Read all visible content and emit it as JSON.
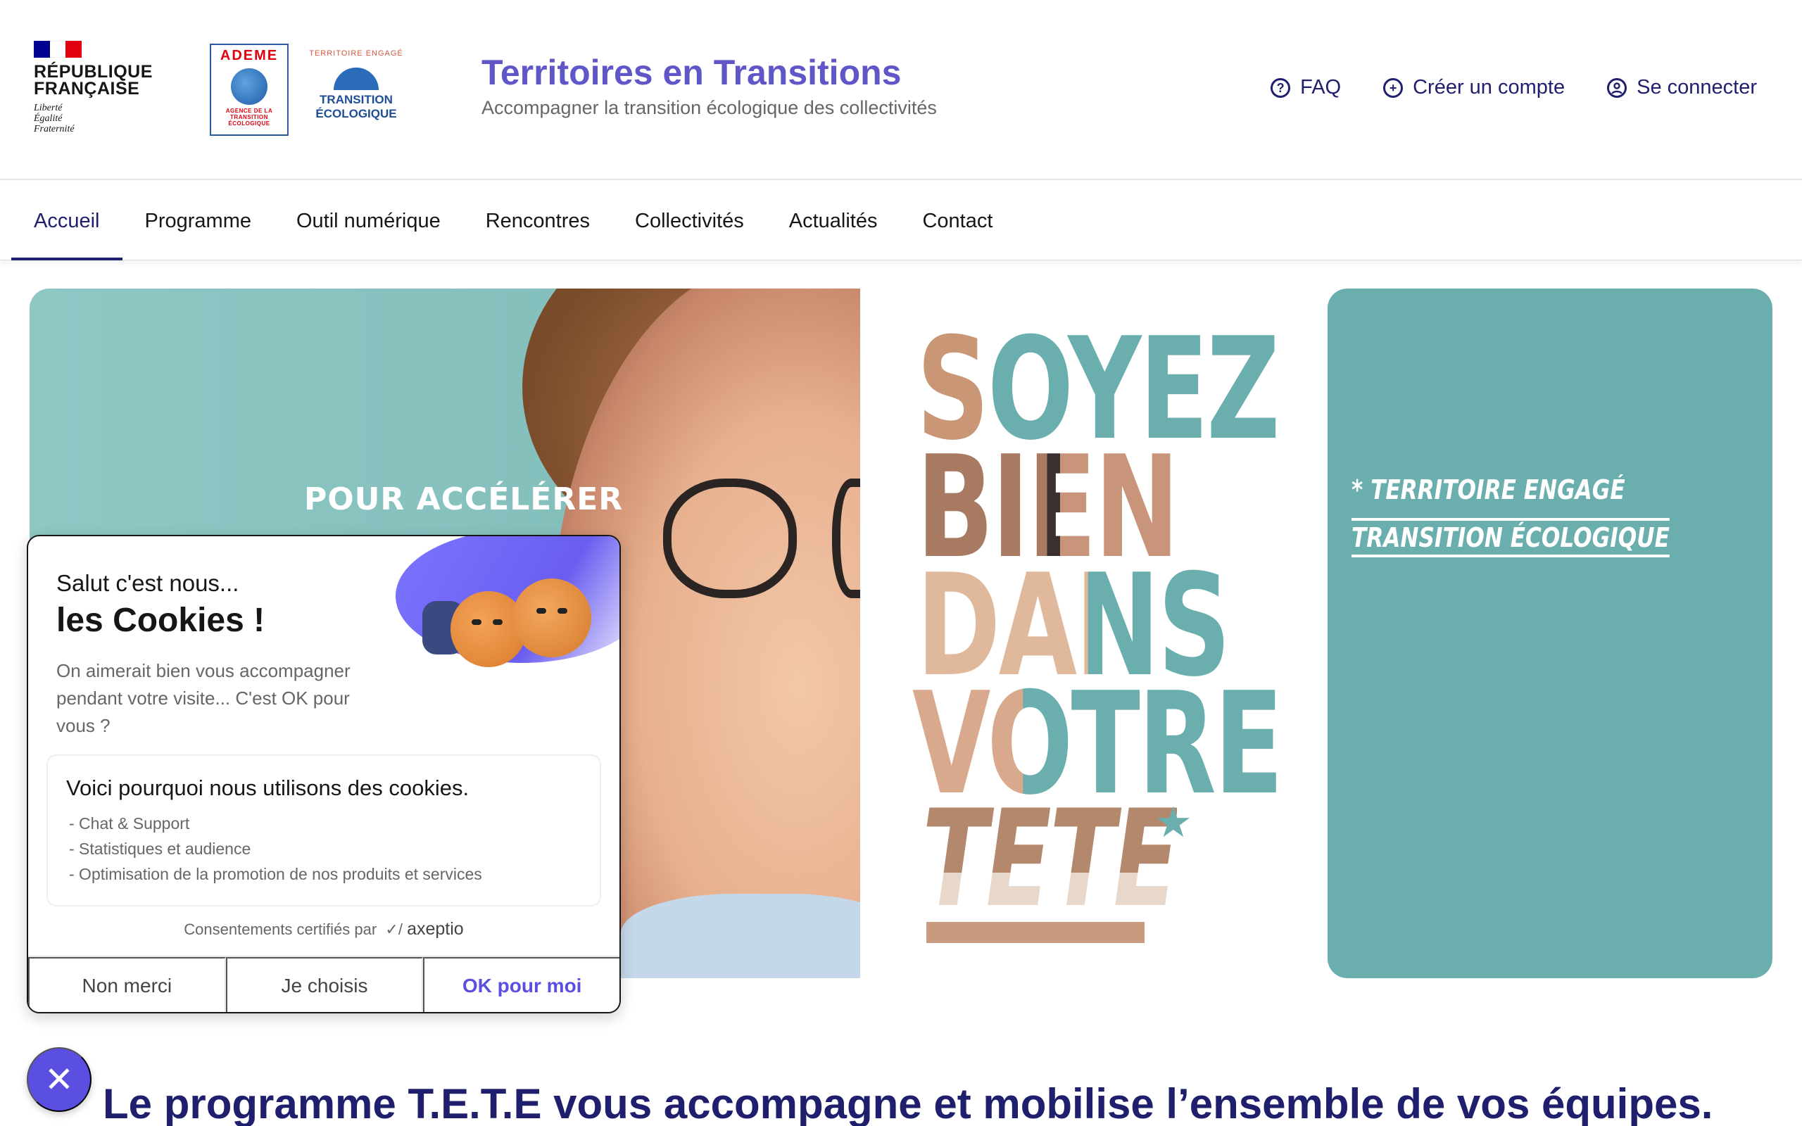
{
  "header": {
    "rf": {
      "line1": "RÉPUBLIQUE",
      "line2": "FRANÇAISE",
      "motto1": "Liberté",
      "motto2": "Égalité",
      "motto3": "Fraternité",
      "flag_colors": [
        "#000091",
        "#ffffff",
        "#e1000f"
      ]
    },
    "ademe": {
      "title": "ADEME",
      "sub1": "AGENCE DE LA",
      "sub2": "TRANSITION",
      "sub3": "ÉCOLOGIQUE"
    },
    "tete": {
      "arc": "TERRITOIRE ENGAGÉ",
      "line1": "TRANSITION",
      "line2": "ÉCOLOGIQUE"
    },
    "site_title": "Territoires en Transitions",
    "tagline": "Accompagner la transition écologique des collectivités",
    "links": [
      {
        "label": "FAQ",
        "icon": "question-circle-icon"
      },
      {
        "label": "Créer un compte",
        "icon": "plus-circle-icon"
      },
      {
        "label": "Se connecter",
        "icon": "user-circle-icon"
      }
    ]
  },
  "nav": {
    "items": [
      "Accueil",
      "Programme",
      "Outil numérique",
      "Rencontres",
      "Collectivités",
      "Actualités",
      "Contact"
    ],
    "active": "Accueil"
  },
  "hero": {
    "left_text1": "POUR ACCÉLÉRER",
    "words": [
      "SOYEZ",
      "BIEN",
      "DANS",
      "VOTRE",
      "TETE"
    ],
    "star": "*",
    "right_line1": "* TERRITOIRE ENGAGÉ",
    "right_line2": "TRANSITION ÉCOLOGIQUE"
  },
  "main": {
    "heading": "Le programme T.E.T.E vous accompagne et mobilise l’ensemble de vos équipes."
  },
  "cookie": {
    "salut": "Salut c'est nous...",
    "title": "les Cookies !",
    "intro": "On aimerait bien vous accompagner pendant votre visite... C'est OK pour vous ?",
    "box_title": "Voici pourquoi nous utilisons des cookies.",
    "reasons": [
      "- Chat & Support",
      "- Statistiques et audience",
      "- Optimisation de la promotion de nos produits et services"
    ],
    "certif": "Consentements certifiés par",
    "brand": "axeptio",
    "buttons": {
      "refuse": "Non merci",
      "choose": "Je choisis",
      "accept": "OK pour moi"
    },
    "accent_color": "#5a4fe0"
  },
  "colors": {
    "brand_blue": "#1f1f6e",
    "title_purple": "#5f56c7",
    "teal": "#6aaeae"
  }
}
